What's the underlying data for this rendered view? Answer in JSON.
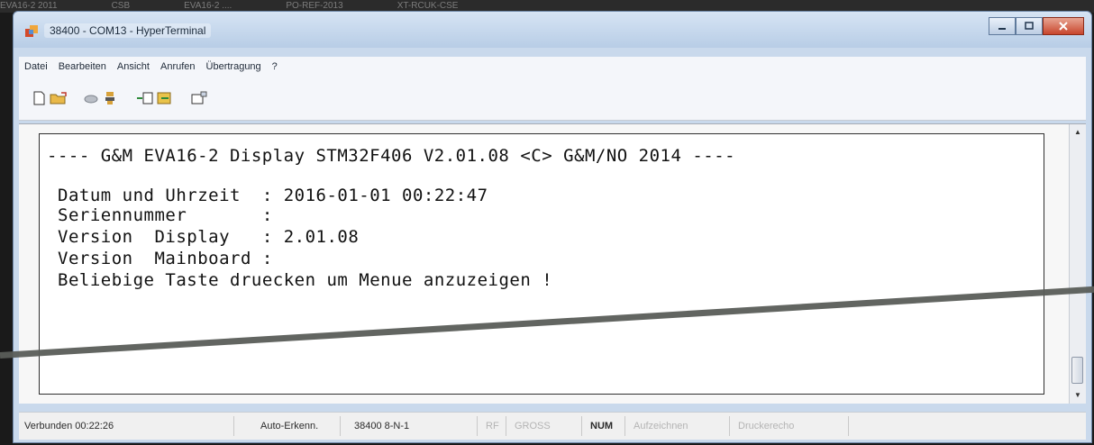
{
  "window": {
    "title": "38400 - COM13 - HyperTerminal"
  },
  "menu": [
    "Datei",
    "Bearbeiten",
    "Ansicht",
    "Anrufen",
    "Übertragung",
    "?"
  ],
  "toolbar": {
    "icons": [
      "new-connection-icon",
      "open-icon",
      "disconnect-icon",
      "dial-icon",
      "send-icon",
      "receive-icon",
      "properties-icon"
    ]
  },
  "terminal": {
    "lines": [
      "---- G&M EVA16-2 Display STM32F406 V2.01.08 <C> G&M/NO 2014 ----",
      "Datum und Uhrzeit  : 2016-01-01 00:22:47",
      "Seriennummer       :",
      "Version  Display   : 2.01.08",
      "Version  Mainboard :",
      "Beliebige Taste druecken um Menue anzuzeigen !"
    ]
  },
  "status": {
    "connected": "Verbunden 00:22:26",
    "detect": "Auto-Erkenn.",
    "params": "38400 8-N-1",
    "scroll": "RF",
    "caps": "GROSS",
    "num": "NUM",
    "capture": "Aufzeichnen",
    "print": "Druckerecho"
  },
  "colors": {
    "title_bar": "#c9d9ec",
    "close_button": "#c8452c",
    "terminal_bg": "#ffffff",
    "terminal_text": "#111111"
  }
}
